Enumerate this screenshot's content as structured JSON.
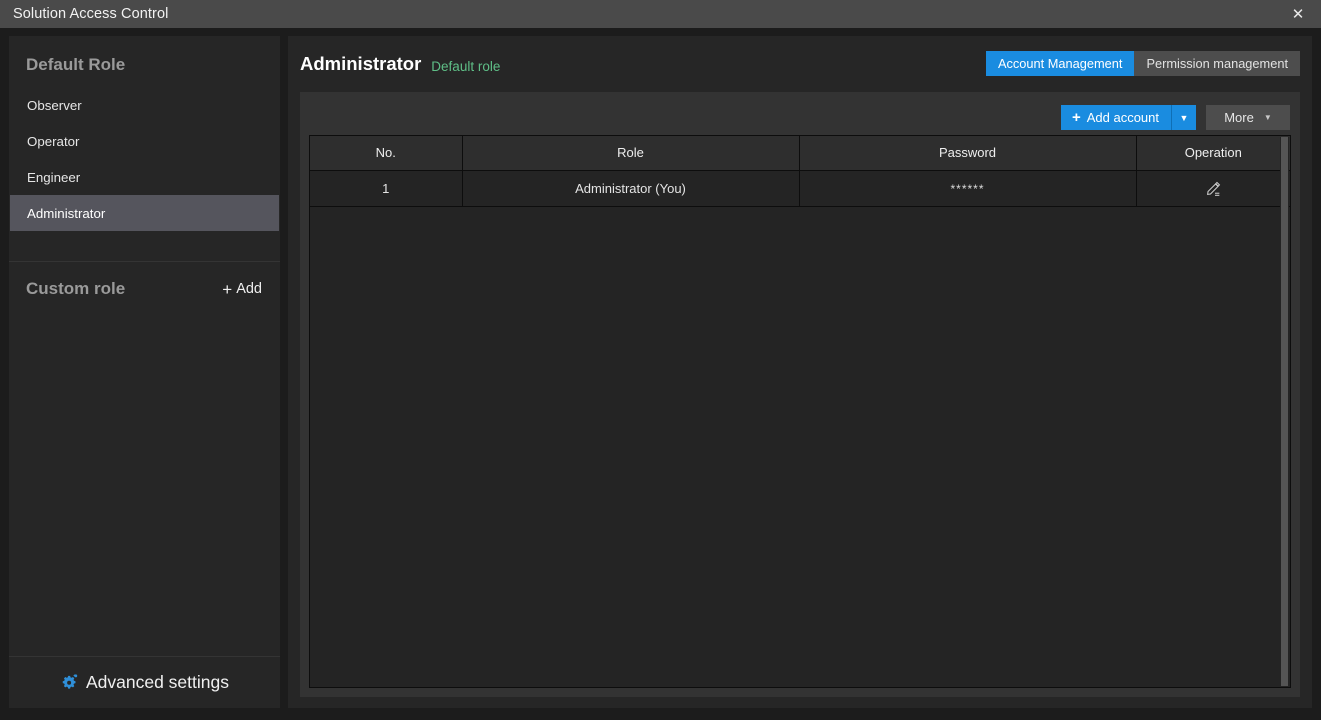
{
  "window": {
    "title": "Solution Access Control",
    "close_icon": "close-icon"
  },
  "sidebar": {
    "default_section_label": "Default Role",
    "default_roles": [
      {
        "label": "Observer",
        "selected": false
      },
      {
        "label": "Operator",
        "selected": false
      },
      {
        "label": "Engineer",
        "selected": false
      },
      {
        "label": "Administrator",
        "selected": true
      }
    ],
    "custom_section_label": "Custom role",
    "custom_add_label": "Add",
    "custom_add_plus": "+",
    "custom_roles": [],
    "footer": {
      "label": "Advanced settings",
      "icon": "gear-icon",
      "icon_color": "#2f8fd8"
    }
  },
  "main": {
    "title": "Administrator",
    "subtitle": "Default role",
    "subtitle_color": "#5fbf87",
    "tabs": [
      {
        "label": "Account Management",
        "active": true
      },
      {
        "label": "Permission management",
        "active": false
      }
    ],
    "toolbar": {
      "add_account_label": "Add account",
      "add_account_plus": "+",
      "add_account_caret": "▼",
      "more_label": "More",
      "more_caret": "▼",
      "accent_color": "#1a8ce0"
    },
    "table": {
      "columns": [
        "No.",
        "Role",
        "Password",
        "Operation"
      ],
      "rows": [
        {
          "no": "1",
          "role": "Administrator (You)",
          "password": "******",
          "operation_icon": "edit-pencil-icon"
        }
      ]
    }
  }
}
